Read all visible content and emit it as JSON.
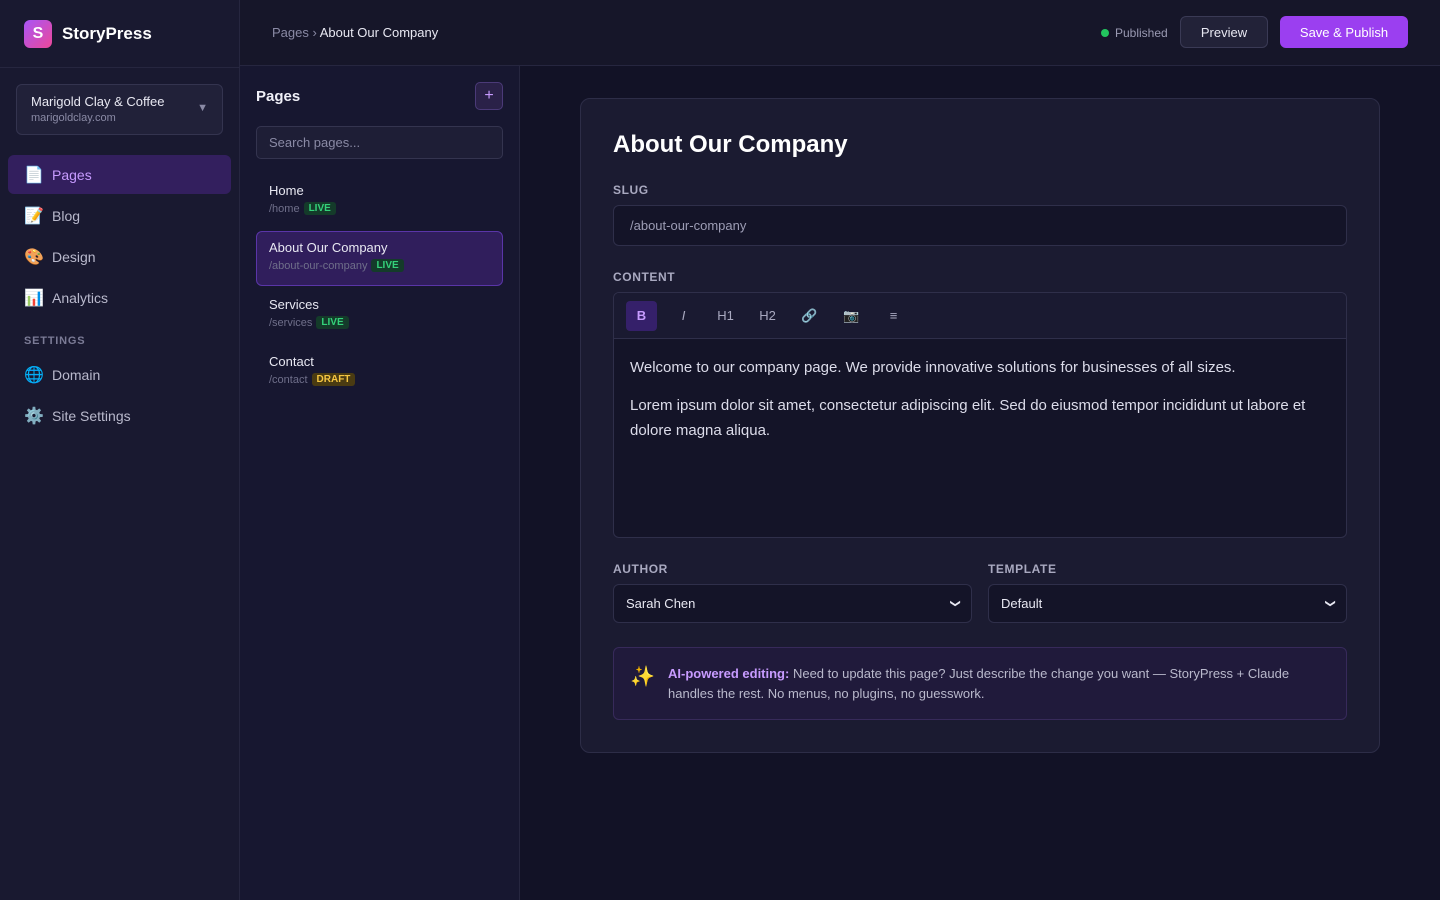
{
  "brand": {
    "logo_letter": "S",
    "name": "StoryPress"
  },
  "site": {
    "name": "Marigold Clay & Coffee",
    "domain": "marigoldclay.com"
  },
  "nav": {
    "items": [
      {
        "icon": "📄",
        "icon_name": "page-icon",
        "label": "Pages",
        "active": true
      },
      {
        "icon": "📝",
        "icon_name": "memo-icon",
        "label": "Blog"
      },
      {
        "icon": "🎨",
        "icon_name": "palette-icon",
        "label": "Design"
      },
      {
        "icon": "📊",
        "icon_name": "chart-icon",
        "label": "Analytics"
      }
    ],
    "settings_label": "SETTINGS",
    "settings_items": [
      {
        "icon": "🌐",
        "icon_name": "globe-icon",
        "label": "Domain"
      },
      {
        "icon": "⚙️",
        "icon_name": "gear-icon",
        "label": "Site Settings"
      }
    ]
  },
  "topbar": {
    "breadcrumb_root": "Pages",
    "breadcrumb_sep": " › ",
    "breadcrumb_current": "About Our Company",
    "status": "Published",
    "status_color": "#22c55e",
    "preview_label": "Preview",
    "publish_label": "Save & Publish"
  },
  "pages_panel": {
    "title": "Pages",
    "add_label": "+",
    "search_placeholder": "Search pages...",
    "pages": [
      {
        "title": "Home",
        "slug": "/home",
        "status": "LIVE"
      },
      {
        "title": "About Our Company",
        "slug": "/about-our-company",
        "status": "LIVE",
        "active": true
      },
      {
        "title": "Services",
        "slug": "/services",
        "status": "LIVE"
      },
      {
        "title": "Contact",
        "slug": "/contact",
        "status": "DRAFT"
      }
    ]
  },
  "editor": {
    "heading": "About Our Company",
    "slug_label": "SLUG",
    "slug_value": "/about-our-company",
    "content_label": "CONTENT",
    "toolbar": [
      {
        "label": "B",
        "name": "bold-button",
        "active": true
      },
      {
        "label": "I",
        "name": "italic-button"
      },
      {
        "label": "H1",
        "name": "heading1-button"
      },
      {
        "label": "H2",
        "name": "heading2-button"
      },
      {
        "label": "🔗",
        "name": "link-icon"
      },
      {
        "label": "📷",
        "name": "camera-icon"
      },
      {
        "label": "≡",
        "name": "list-icon"
      }
    ],
    "paragraphs": [
      "Welcome to our company page. We provide innovative solutions for businesses of all sizes.",
      "Lorem ipsum dolor sit amet, consectetur adipiscing elit. Sed do eiusmod tempor incididunt ut labore et dolore magna aliqua."
    ],
    "author_label": "AUTHOR",
    "author_value": "Sarah Chen",
    "template_label": "TEMPLATE",
    "template_value": "Default",
    "ai_icon": "✨",
    "ai_strong": "AI-powered editing:",
    "ai_text": " Need to update this page? Just describe the change you want — StoryPress + Claude handles the rest. No menus, no plugins, no guesswork."
  },
  "colors": {
    "accent": "#9b3ff0",
    "live": "#34d27a",
    "draft": "#f5c542"
  }
}
